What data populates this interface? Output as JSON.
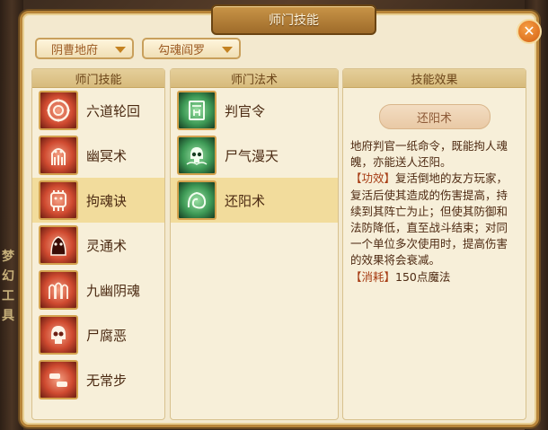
{
  "background": {
    "sign_chars": [
      "梦",
      "幻",
      "工",
      "具"
    ]
  },
  "window": {
    "title": "师门技能",
    "close_glyph": "✕",
    "filters": {
      "school": "阴曹地府",
      "master": "勾魂阎罗"
    }
  },
  "panels": {
    "skills_header": "师门技能",
    "spells_header": "师门法术",
    "effect_header": "技能效果"
  },
  "skills": [
    {
      "label": "六道轮回",
      "icon": "wheel-icon"
    },
    {
      "label": "幽冥术",
      "icon": "ghost-hands-icon"
    },
    {
      "label": "拘魂诀",
      "icon": "claw-icon"
    },
    {
      "label": "灵通术",
      "icon": "spirit-icon"
    },
    {
      "label": "九幽阴魂",
      "icon": "souls-icon"
    },
    {
      "label": "尸腐恶",
      "icon": "skull-icon"
    },
    {
      "label": "无常步",
      "icon": "footsteps-icon"
    }
  ],
  "selected_skill": "拘魂诀",
  "spells": [
    {
      "label": "判官令",
      "icon": "tablet-icon"
    },
    {
      "label": "尸气漫天",
      "icon": "skull-cloud-icon"
    },
    {
      "label": "还阳术",
      "icon": "revive-icon"
    }
  ],
  "selected_spell": "还阳术",
  "effect": {
    "name": "还阳术",
    "intro": "地府判官一纸命令，既能拘人魂魄，亦能送人还阳。",
    "effect_tag": "【功效】",
    "effect_text": "复活倒地的友方玩家，复活后使其造成的伤害提高，持续到其阵亡为止；但使其防御和法防降低，直至战斗结束；对同一个单位多次使用时，提高伤害的效果将会衰减。",
    "cost_tag": "【消耗】",
    "cost_text": "150点魔法"
  },
  "colors": {
    "accent": "#b8863b",
    "selected_row": "#f2dc9c",
    "text": "#4b2a12"
  }
}
